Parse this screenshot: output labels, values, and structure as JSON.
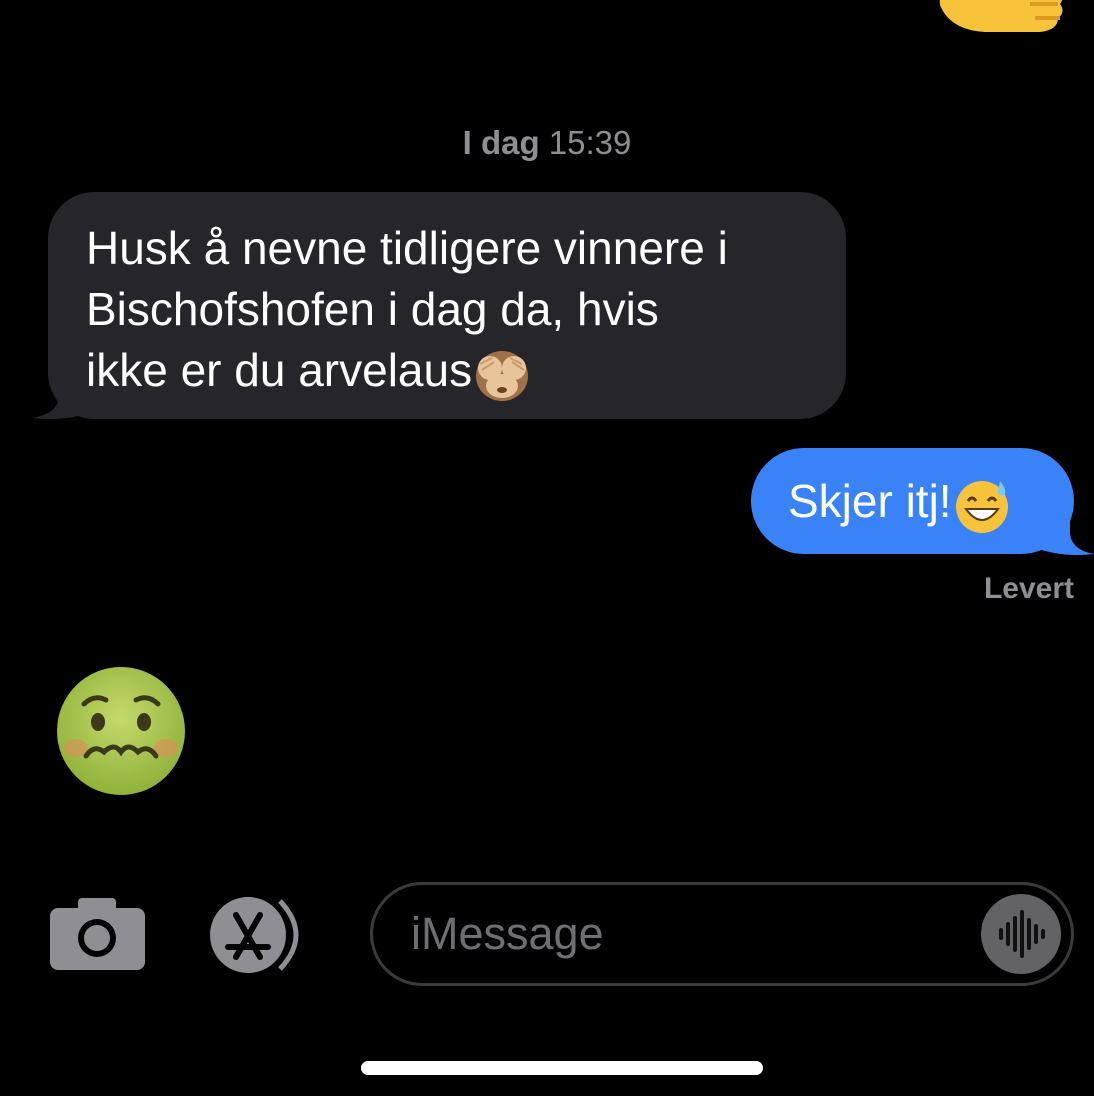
{
  "conversation": {
    "timestamp_day": "I dag",
    "timestamp_time": "15:39",
    "incoming_message": {
      "line1": "Husk å nevne tidligere vinnere i",
      "line2": "Bischofshofen i dag da, hvis",
      "line3": "ikke er du arvelaus",
      "trailing_emoji": "see-no-evil-monkey-icon"
    },
    "outgoing_message": {
      "text": "Skjer itj!",
      "trailing_emoji": "grinning-sweat-icon"
    },
    "delivery_status": "Levert",
    "incoming_big_emoji": "nauseated-face-icon",
    "top_cropped_emoji": "thumbs-up-icon"
  },
  "composer": {
    "placeholder": "iMessage",
    "camera_icon": "camera-icon",
    "apps_icon": "app-store-icon",
    "audio_icon": "audio-waveform-icon"
  },
  "colors": {
    "background": "#000000",
    "incoming_bubble": "#26262a",
    "outgoing_bubble": "#3a82f7",
    "secondary_text": "#8e8e93"
  }
}
